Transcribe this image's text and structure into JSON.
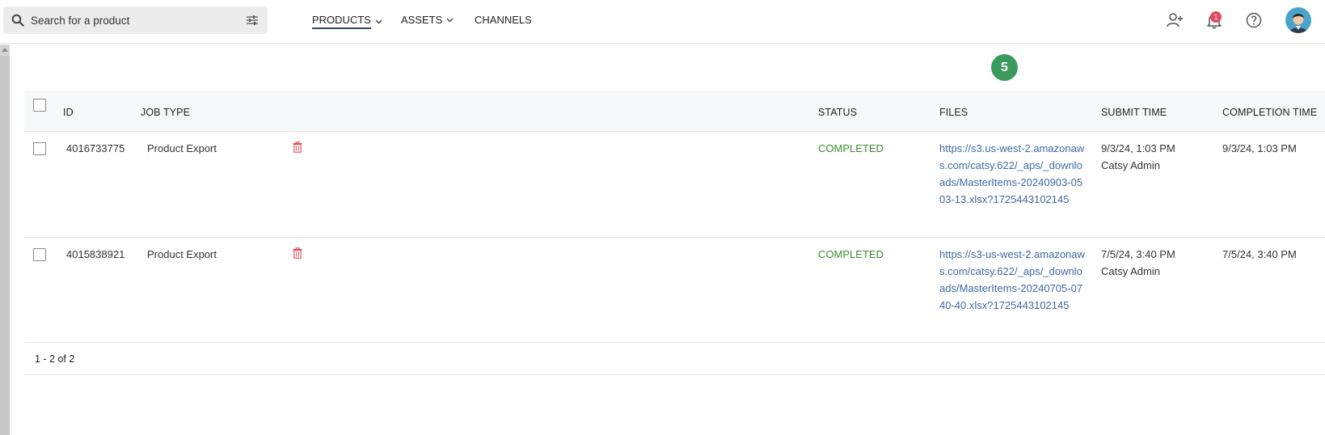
{
  "search": {
    "placeholder": "Search for a product"
  },
  "nav": {
    "products": "PRODUCTS",
    "assets": "ASSETS",
    "channels": "CHANNELS"
  },
  "notifications": {
    "count": "1"
  },
  "step_marker": "5",
  "table": {
    "headers": {
      "id": "ID",
      "job_type": "JOB TYPE",
      "status": "STATUS",
      "files": "FILES",
      "submit_time": "SUBMIT TIME",
      "completion_time": "COMPLETION TIME"
    },
    "rows": [
      {
        "id": "4016733775",
        "job_type": "Product Export",
        "status": "COMPLETED",
        "file": "https://s3.us-west-2.amazonaws.com/catsy.622/_aps/_downloads/MasterItems-20240903-0503-13.xlsx?1725443102145",
        "submit_time": "9/3/24, 1:03 PM",
        "submitted_by": "Catsy Admin",
        "completion_time": "9/3/24, 1:03 PM"
      },
      {
        "id": "4015838921",
        "job_type": "Product Export",
        "status": "COMPLETED",
        "file": "https://s3-us-west-2.amazonaws.com/catsy.622/_aps/_downloads/MasterItems-20240705-0740-40.xlsx?1725443102145",
        "submit_time": "7/5/24, 3:40 PM",
        "submitted_by": "Catsy Admin",
        "completion_time": "7/5/24, 3:40 PM"
      }
    ]
  },
  "pagination": {
    "summary": "1 - 2 of 2"
  },
  "colors": {
    "status_completed": "#3d8b2e",
    "link": "#3e6aa3",
    "trash": "#e5485a",
    "badge": "#e5485a",
    "step_marker": "#3a9a5b"
  },
  "icons": [
    "search-icon",
    "filter-icon",
    "chevron-down-icon",
    "add-user-icon",
    "bell-icon",
    "help-icon",
    "avatar",
    "trash-icon"
  ]
}
